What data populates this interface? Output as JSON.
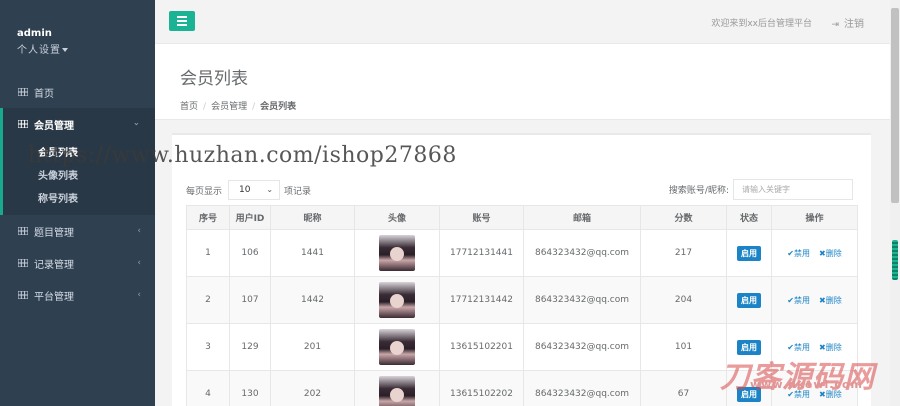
{
  "profile": {
    "name": "admin",
    "settings": "个人设置"
  },
  "sidebar": {
    "items": [
      {
        "label": "首页"
      },
      {
        "label": "会员管理"
      },
      {
        "label": "题目管理"
      },
      {
        "label": "记录管理"
      },
      {
        "label": "平台管理"
      }
    ],
    "subitems": [
      {
        "label": "会员列表"
      },
      {
        "label": "头像列表"
      },
      {
        "label": "称号列表"
      }
    ]
  },
  "topbar": {
    "welcome": "欢迎来到xx后台管理平台",
    "logout": "注销"
  },
  "page": {
    "title": "会员列表",
    "breadcrumb": [
      "首页",
      "会员管理",
      "会员列表"
    ]
  },
  "controls": {
    "per_page_label": "每页显示",
    "per_page_value": "10",
    "per_page_suffix": "项记录",
    "search_label": "搜索账号/昵称:",
    "search_placeholder": "请输入关键字"
  },
  "table": {
    "headers": [
      "序号",
      "用户ID",
      "昵称",
      "头像",
      "账号",
      "邮箱",
      "分数",
      "状态",
      "操作"
    ],
    "rows": [
      {
        "index": "1",
        "uid": "106",
        "nickname": "1441",
        "account": "17712131441",
        "email": "864323432@qq.com",
        "score": "217",
        "status": "启用"
      },
      {
        "index": "2",
        "uid": "107",
        "nickname": "1442",
        "account": "17712131442",
        "email": "864323432@qq.com",
        "score": "204",
        "status": "启用"
      },
      {
        "index": "3",
        "uid": "129",
        "nickname": "201",
        "account": "13615102201",
        "email": "864323432@qq.com",
        "score": "101",
        "status": "启用"
      },
      {
        "index": "4",
        "uid": "130",
        "nickname": "202",
        "account": "13615102202",
        "email": "864323432@qq.com",
        "score": "67",
        "status": "启用"
      }
    ],
    "op_disable": "禁用",
    "op_delete": "删除"
  },
  "watermark": {
    "url": "https://www.huzhan.com/ishop27868",
    "brand": "刀客源码网",
    "brand_sub": "www.dkewl.com"
  },
  "colors": {
    "sidebar": "#2f4050",
    "accent": "#1ab394",
    "primary": "#1c84c6"
  },
  "icons": {
    "nav": "grid-icon",
    "menu": "bars-icon",
    "logout": "sign-out-icon",
    "disable": "check-circle-icon",
    "delete": "times-icon"
  }
}
